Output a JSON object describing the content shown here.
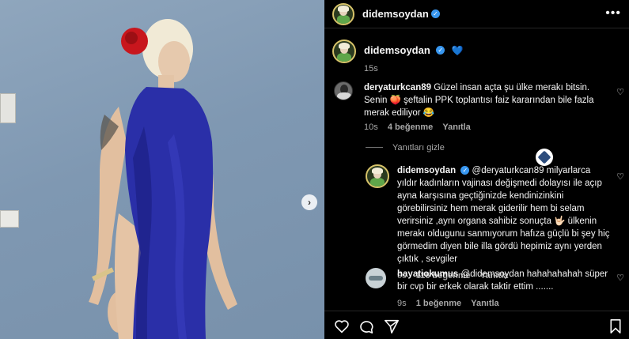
{
  "post_author": {
    "username": "didemsoydan",
    "verified": true
  },
  "caption": {
    "username": "didemsoydan",
    "emoji": "💙",
    "time": "15s"
  },
  "comments": [
    {
      "username": "deryaturkcan89",
      "text": "Güzel insan açta şu ülke merakı bitsin. Senin 🍑 şeftalin PPK toplantısı faiz kararından bile fazla merak ediliyor 😂",
      "time": "10s",
      "likes": "4 beğenme",
      "reply": "Yanıtla"
    }
  ],
  "hide_replies": "Yanıtları gizle",
  "replies": [
    {
      "username": "didemsoydan",
      "text": "@deryaturkcan89 milyarlarca yıldır kadınların vajinası değişmedi dolayısı ile açıp ayna karşısına geçtiğinizde kendinizinkini görebilirsiniz hem merak giderilir hem bi selam verirsiniz ,aynı organa sahibiz sonuçta 🤟🏻 ülkenin merakı oldugunu sanmıyorum hafıza güçlü bi şey hiç görmedim diyen bile illa gördü hepimiz aynı yerden çıktık , sevgiler",
      "time": "9s",
      "likes": "116 beğenme",
      "reply": "Yanıtla"
    },
    {
      "username": "hayatiokumus",
      "text": "@didemsoydan hahahahahah süper bir cvp bir erkek olarak taktir ettim .......",
      "time": "9s",
      "likes": "1 beğenme",
      "reply": "Yanıtla"
    }
  ],
  "icons": {
    "more": "more-options-icon",
    "like": "heart-icon",
    "comment": "comment-icon",
    "share": "share-icon",
    "save": "bookmark-icon",
    "next": "chevron-right-icon"
  },
  "colors": {
    "background": "#000000",
    "verified": "#3897f0",
    "dress": "#2a2fa8",
    "rose": "#c8161d",
    "wall": "#8ba2b9"
  }
}
